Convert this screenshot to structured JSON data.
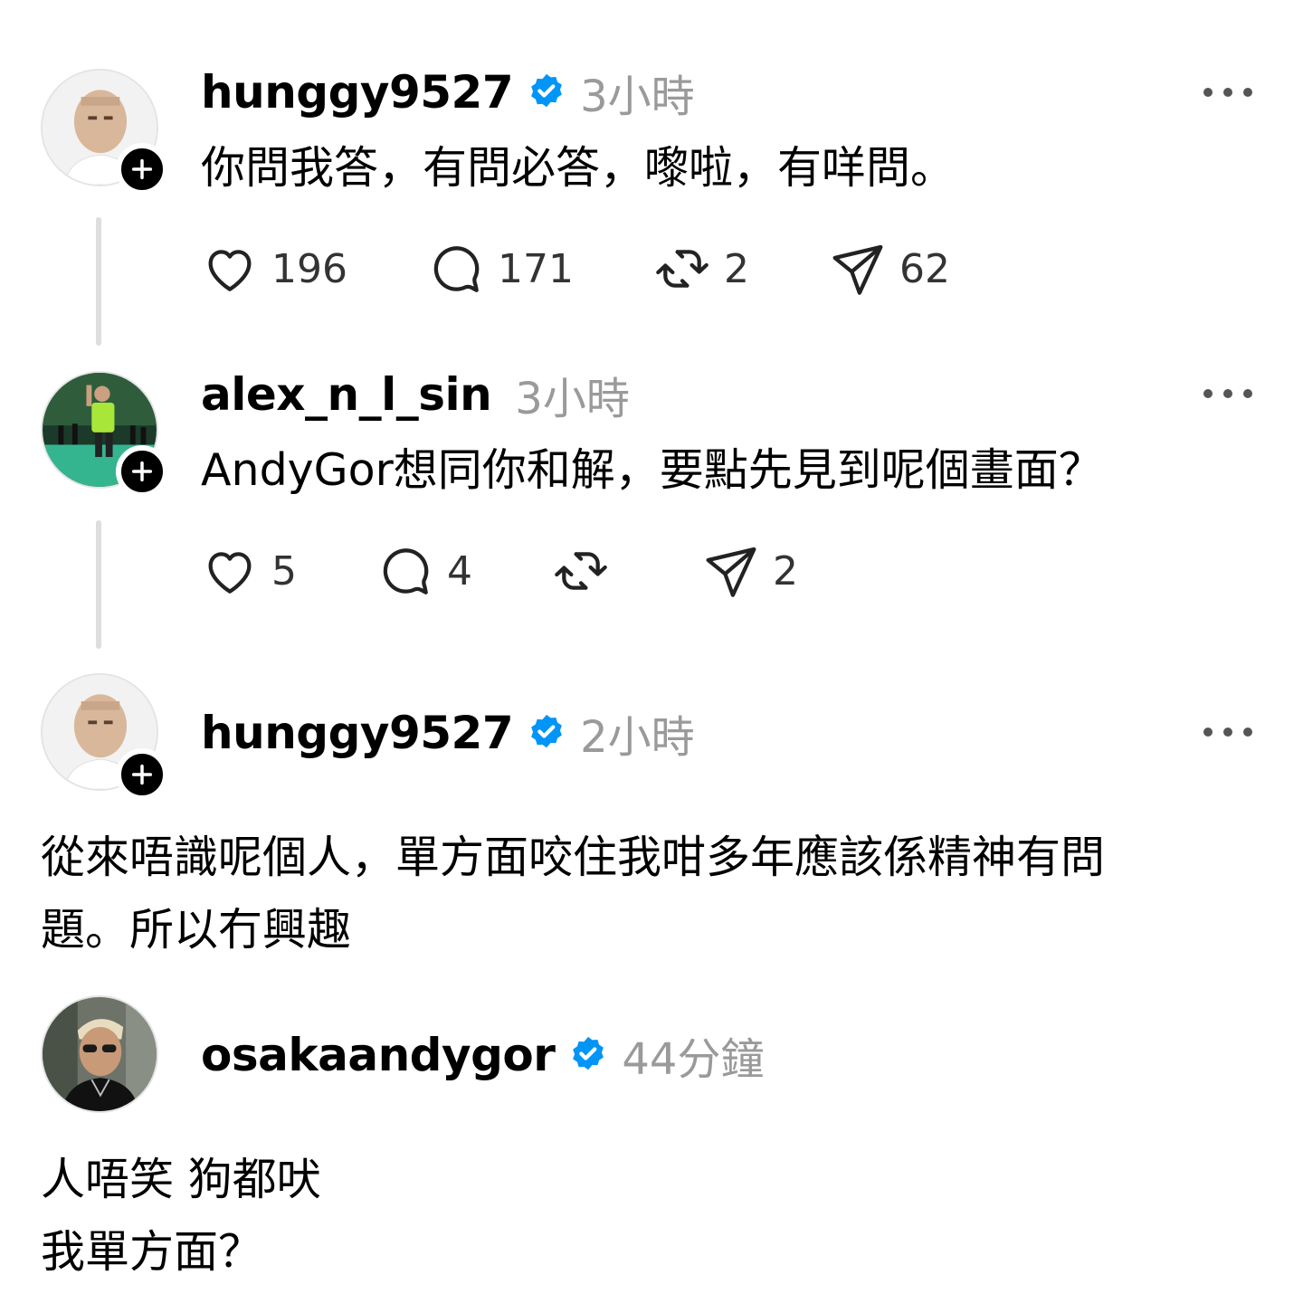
{
  "posts": [
    {
      "username": "hunggy9527",
      "verified": true,
      "time": "3小時",
      "text_lines": [
        "你問我答，有問必答，嚟啦，有咩問。"
      ],
      "actions": {
        "likes": "196",
        "replies": "171",
        "reposts": "2",
        "shares": "62"
      }
    },
    {
      "username": "alex_n_l_sin",
      "verified": false,
      "time": "3小時",
      "text_lines": [
        "AndyGor想同你和解，要點先見到呢個畫面？"
      ],
      "actions": {
        "likes": "5",
        "replies": "4",
        "reposts": "",
        "shares": "2"
      }
    },
    {
      "username": "hunggy9527",
      "verified": true,
      "time": "2小時",
      "text_lines": [
        "從來唔識呢個人，單方面咬住我咁多年應該係精神有問",
        "題。所以冇興趣"
      ]
    },
    {
      "username": "osakaandygor",
      "verified": true,
      "time": "44分鐘",
      "text_lines": [
        "人唔笑 狗都吠",
        "我單方面？"
      ]
    }
  ],
  "colors": {
    "verified": "#0095f6",
    "timestamp": "#9a9a9a",
    "thread_line": "#dedede"
  },
  "icons": {
    "like": "heart-icon",
    "reply": "comment-icon",
    "repost": "repost-icon",
    "share": "send-icon",
    "more": "more-icon",
    "follow": "plus-icon",
    "verified": "verified-badge-icon"
  }
}
